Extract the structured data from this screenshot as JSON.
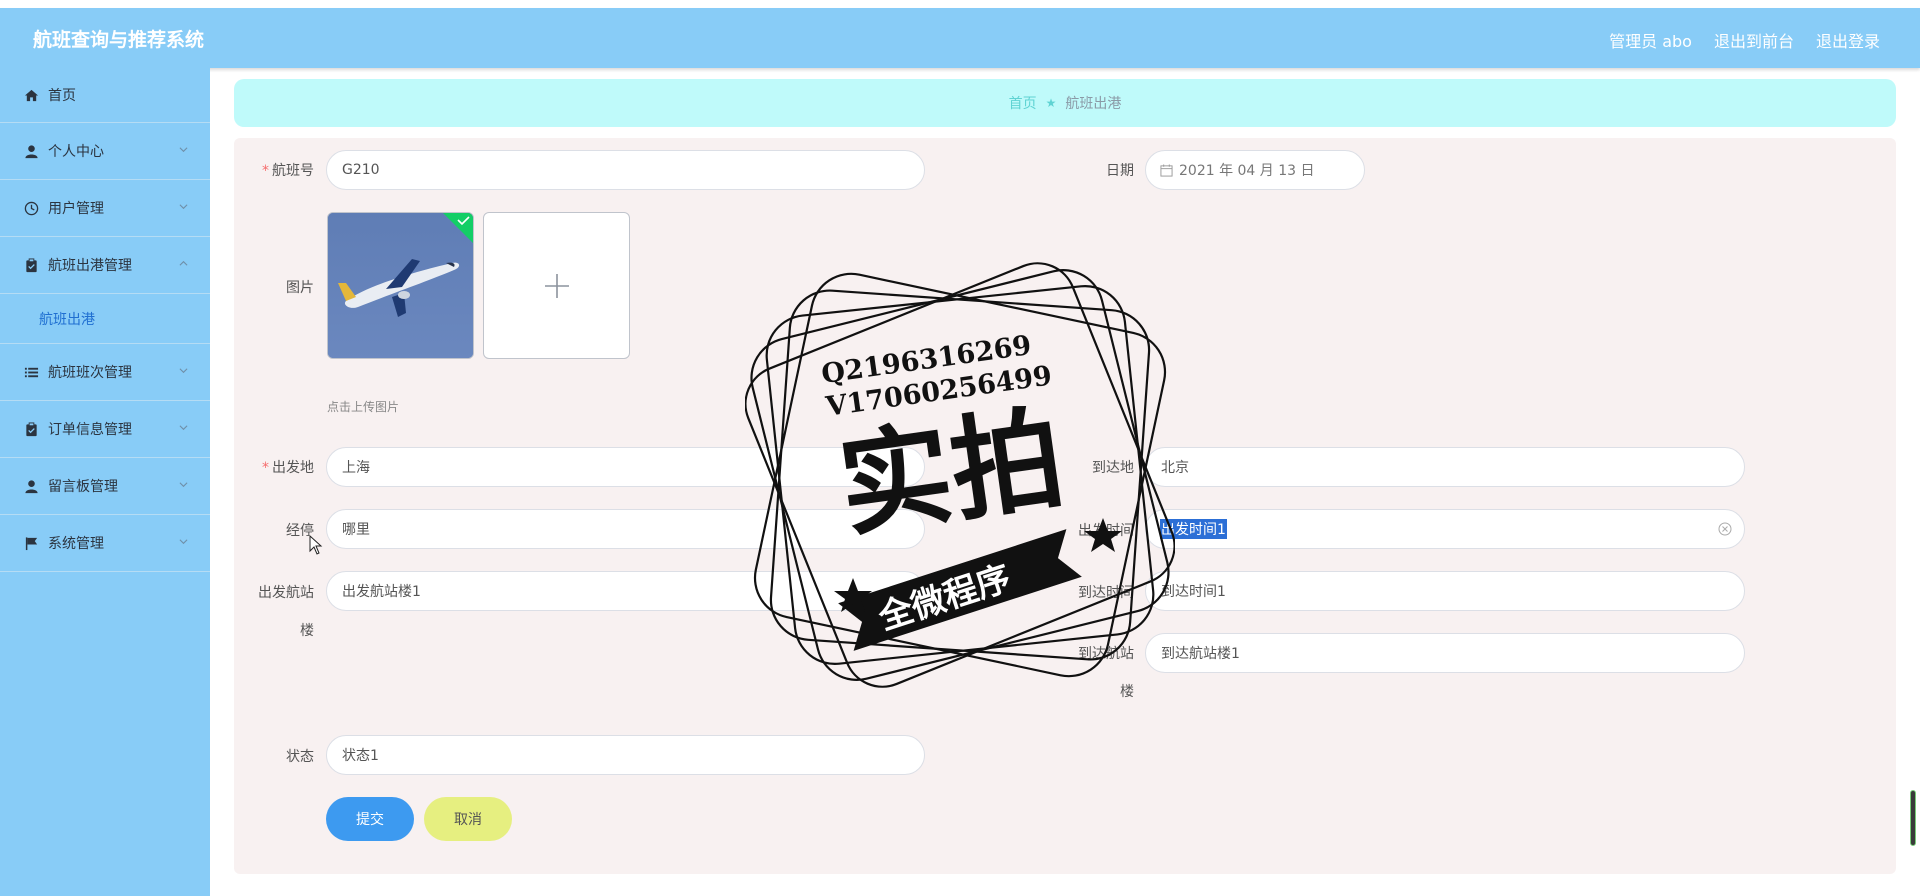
{
  "header": {
    "title": "航班查询与推荐系统",
    "admin_label": "管理员 abo",
    "back_to_front": "退出到前台",
    "logout": "退出登录"
  },
  "sidebar": {
    "items": [
      {
        "label": "首页",
        "icon": "home-icon"
      },
      {
        "label": "个人中心",
        "icon": "user-icon"
      },
      {
        "label": "用户管理",
        "icon": "clock-icon"
      },
      {
        "label": "航班出港管理",
        "icon": "clipboard-icon",
        "expanded": true,
        "children": [
          "航班出港"
        ]
      },
      {
        "label": "航班班次管理",
        "icon": "list-icon"
      },
      {
        "label": "订单信息管理",
        "icon": "clipboard-icon"
      },
      {
        "label": "留言板管理",
        "icon": "user-icon"
      },
      {
        "label": "系统管理",
        "icon": "flag-icon"
      }
    ]
  },
  "breadcrumb": {
    "home": "首页",
    "current": "航班出港"
  },
  "form": {
    "flight_no_label": "航班号",
    "flight_no": "G210",
    "date_label": "日期",
    "date": "2021 年 04 月 13 日",
    "image_label": "图片",
    "upload_tip": "点击上传图片",
    "origin_label": "出发地",
    "origin": "上海",
    "dest_label": "到达地",
    "dest": "北京",
    "via_label": "经停",
    "via": "哪里",
    "depart_time_label": "出发时间",
    "depart_time": "出发时间1",
    "depart_terminal_label_1": "出发航站",
    "depart_terminal_label_2": "楼",
    "depart_terminal": "出发航站楼1",
    "arrive_time_label": "到达时间",
    "arrive_time": "到达时间1",
    "arrive_terminal_label_1": "到达航站",
    "arrive_terminal_label_2": "楼",
    "arrive_terminal": "到达航站楼1",
    "status_label": "状态",
    "status": "状态1",
    "submit": "提交",
    "cancel": "取消"
  },
  "watermark": {
    "line1": "Q2196316269",
    "line2": "V17060256499",
    "main": "实拍",
    "banner": "全微程序"
  },
  "colors": {
    "topbar": "#88ccf7",
    "breadcrumb_bg": "#bffafa",
    "submit": "#3d9af0",
    "cancel": "#e6ef80",
    "required": "#f56c6c"
  }
}
